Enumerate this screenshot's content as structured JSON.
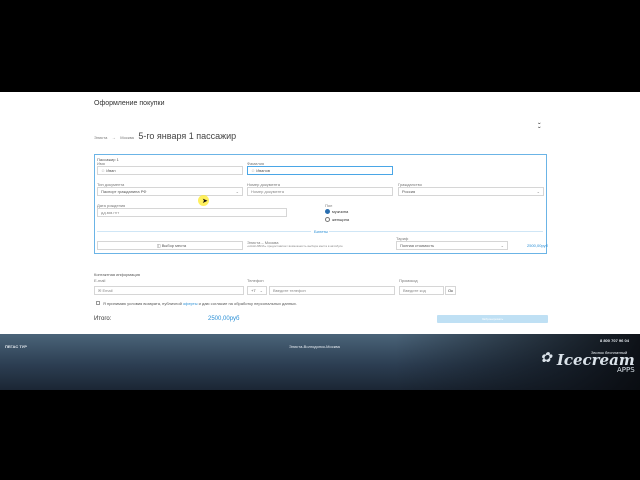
{
  "page": {
    "title": "Оформление покупки",
    "route": {
      "from": "Элиста",
      "arrow": "→",
      "to": "Москва",
      "summary": "5-го января 1 пассажир"
    }
  },
  "passenger": {
    "header": "Пассажир 1",
    "first_name_label": "Имя",
    "first_name_value": "Иван",
    "last_name_label": "Фамилия",
    "last_name_value": "Иванов",
    "doc_type_label": "Тип документа",
    "doc_type_value": "Паспорт гражданина РФ",
    "doc_number_label": "Номер документа",
    "doc_number_placeholder": "Номер документа",
    "citizenship_label": "Гражданство",
    "citizenship_value": "Россия",
    "birth_date_label": "Дата рождения",
    "birth_date_placeholder": "дд.мм.гггг",
    "gender_label": "Пол",
    "gender_male": "мужчина",
    "gender_female": "женщина",
    "separator_label": "Билеты",
    "seat_button": "Выбор места",
    "trip_route": "Элиста – Москва",
    "trip_note": "«НАШ АВИА» предоставляет возможность выбора места в автобусе",
    "tariff_label": "Тариф",
    "tariff_value": "Полная стоимость",
    "price": "2500,00руб"
  },
  "contacts": {
    "header": "Контактная информация",
    "email_label": "E-mail",
    "email_placeholder": "Email",
    "phone_label": "Телефон",
    "phone_code": "+7",
    "phone_placeholder": "Введите телефон",
    "promo_label": "Промокод",
    "promo_placeholder": "Введите код",
    "promo_button": "Ок",
    "terms_prefix": "Я принимаю условия возврата, публичной",
    "terms_link": "оферты",
    "terms_suffix": "и даю согласие на обработку персональных данных."
  },
  "total": {
    "label": "Итого:",
    "value": "2500,00руб",
    "button": "Забронировать"
  },
  "footer": {
    "brand": "ПЕГАС ТУР",
    "route": "Элиста-Волгодонск-Москва",
    "phone": "8 800 707 96 04",
    "callback": "Звонок бесплатный"
  },
  "watermark": {
    "line1": "Icecream",
    "line2": "APPS"
  },
  "colors": {
    "accent": "#2a8fd6",
    "panel_border": "#6bb4e6",
    "footer_bg": "#2c3e52"
  }
}
